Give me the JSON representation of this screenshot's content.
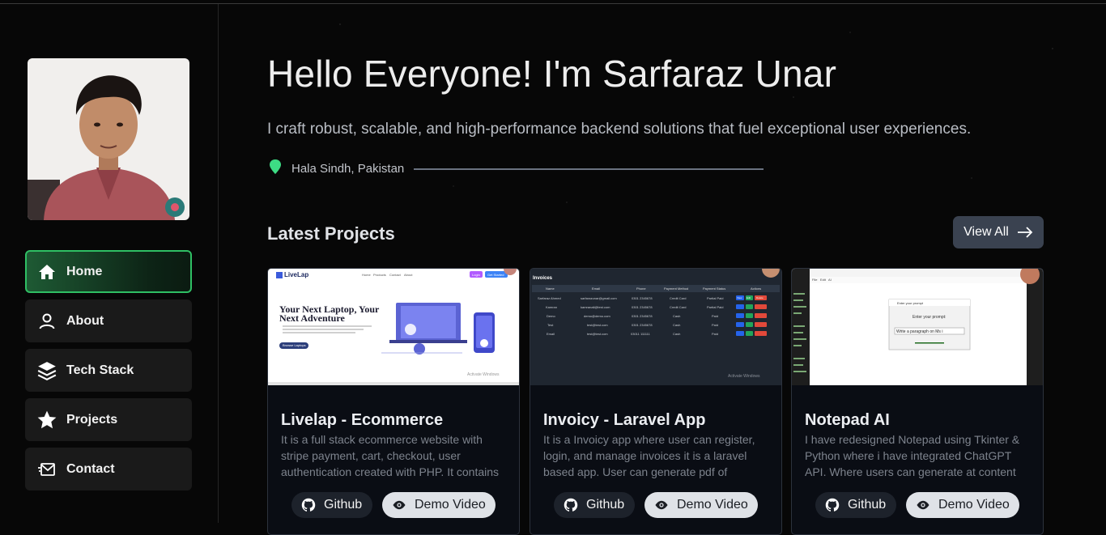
{
  "sidebar": {
    "nav": [
      {
        "label": "Home",
        "icon": "home-icon",
        "active": true
      },
      {
        "label": "About",
        "icon": "user-icon",
        "active": false
      },
      {
        "label": "Tech Stack",
        "icon": "layers-icon",
        "active": false
      },
      {
        "label": "Projects",
        "icon": "star-icon",
        "active": false
      },
      {
        "label": "Contact",
        "icon": "mail-icon",
        "active": false
      }
    ]
  },
  "hero": {
    "title": "Hello Everyone! I'm Sarfaraz Unar",
    "subtitle": "I craft robust, scalable, and high-performance backend solutions that fuel exceptional user experiences.",
    "location": "Hala Sindh, Pakistan"
  },
  "projects": {
    "heading": "Latest Projects",
    "view_all": "View All",
    "cards": [
      {
        "title": "Livelap - Ecommerce",
        "description": "It is a full stack ecommerce website with stripe payment, cart, checkout, user authentication created with PHP. It contains admin panel and user dashboard.",
        "github": "Github",
        "demo": "Demo Video",
        "thumb": {
          "brand": "LiveLap",
          "nav": [
            "Home",
            "Products",
            "Contact",
            "About"
          ],
          "login": "Login",
          "get_started": "Get Started",
          "headline_1": "Your Next Laptop, Your",
          "headline_2": "Next Adventure",
          "cta": "Browse Laptops",
          "watermark": "Activate Windows"
        }
      },
      {
        "title": "Invoicy - Laravel App",
        "description": "It is a Invoicy app where user can register, login, and manage invoices it is a laravel based app. User can generate pdf of invoices and more.",
        "github": "Github",
        "demo": "Demo Video",
        "thumb": {
          "heading": "Invoices",
          "columns": [
            "Name",
            "Email",
            "Phone",
            "Payment Method",
            "Payment Status",
            "Actions"
          ],
          "rows": [
            [
              "Sarfaraz Ahmed",
              "sarfarazunar@gmail.com",
              "0301 2345678",
              "Credit Card",
              "Partial Paid"
            ],
            [
              "Kamran",
              "kamranali@test.com",
              "0301 2345678",
              "Credit Card",
              "Partial Paid"
            ],
            [
              "Demo",
              "demo@demo.com",
              "0301 2345678",
              "Cash",
              "Paid"
            ],
            [
              "Test",
              "test@test.com",
              "0301 2345678",
              "Cash",
              "Paid"
            ],
            [
              "Email",
              "test@test.com",
              "03011 111111",
              "Cash",
              "Paid"
            ]
          ],
          "actions": [
            "View",
            "Edit",
            "Delete"
          ],
          "watermark": "Activate Windows"
        }
      },
      {
        "title": "Notepad AI",
        "description": "I have redesigned Notepad using Tkinter & Python where i have integrated ChatGPT API. Where users can generate at content instantly.",
        "github": "Github",
        "demo": "Demo Video",
        "thumb": {
          "dialog_title": "Enter your prompt",
          "dialog_label": "Enter your prompt:",
          "dialog_input": "Write a paragraph on Ms i",
          "menu": [
            "File",
            "Edit",
            "AI"
          ]
        }
      }
    ]
  },
  "colors": {
    "background": "#070707",
    "nav_active_border": "#2fbf64",
    "nav_bg": "#1a1a1a",
    "location_pin": "#3ddc84",
    "view_all_bg": "#3a4250",
    "card_bg": "#0a0d14"
  }
}
